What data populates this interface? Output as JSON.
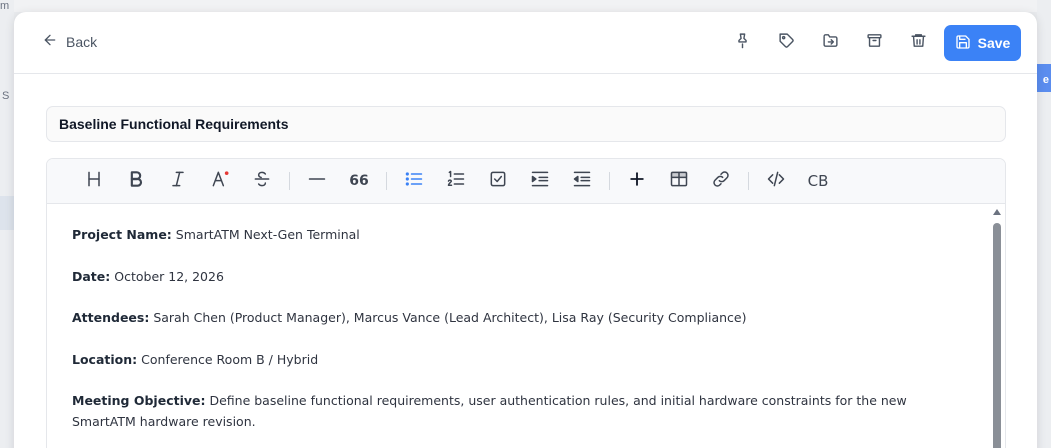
{
  "background": {
    "fragment_top_left": "m",
    "fragment_left": "S",
    "fragment_right": "e"
  },
  "header": {
    "back_label": "Back",
    "actions": [
      "pin-icon",
      "tag-icon",
      "move-icon",
      "archive-icon",
      "trash-icon"
    ],
    "save_label": "Save"
  },
  "note": {
    "title": "Baseline Functional Requirements"
  },
  "toolbar": {
    "buttons": [
      "heading",
      "bold",
      "italic",
      "text-color",
      "strikethrough",
      "horizontal-rule",
      "quote",
      "bullet-list",
      "ordered-list",
      "task-list",
      "indent",
      "outdent",
      "insert",
      "table",
      "link",
      "code",
      "code-block"
    ],
    "quote_glyph": "66",
    "code_block_label": "CB"
  },
  "content": {
    "project_label": "Project Name:",
    "project_value": "SmartATM Next-Gen Terminal",
    "date_label": "Date:",
    "date_value": "October 12, 2026",
    "attendees_label": "Attendees:",
    "attendees_value": "Sarah Chen (Product Manager), Marcus Vance (Lead Architect), Lisa Ray (Security Compliance)",
    "location_label": "Location:",
    "location_value": "Conference Room B / Hybrid",
    "objective_label": "Meeting Objective:",
    "objective_value": "Define baseline functional requirements, user authentication rules, and initial hardware constraints for the new SmartATM hardware revision."
  },
  "colors": {
    "accent": "#3b82f6",
    "text_color_dot": "#e53935"
  }
}
